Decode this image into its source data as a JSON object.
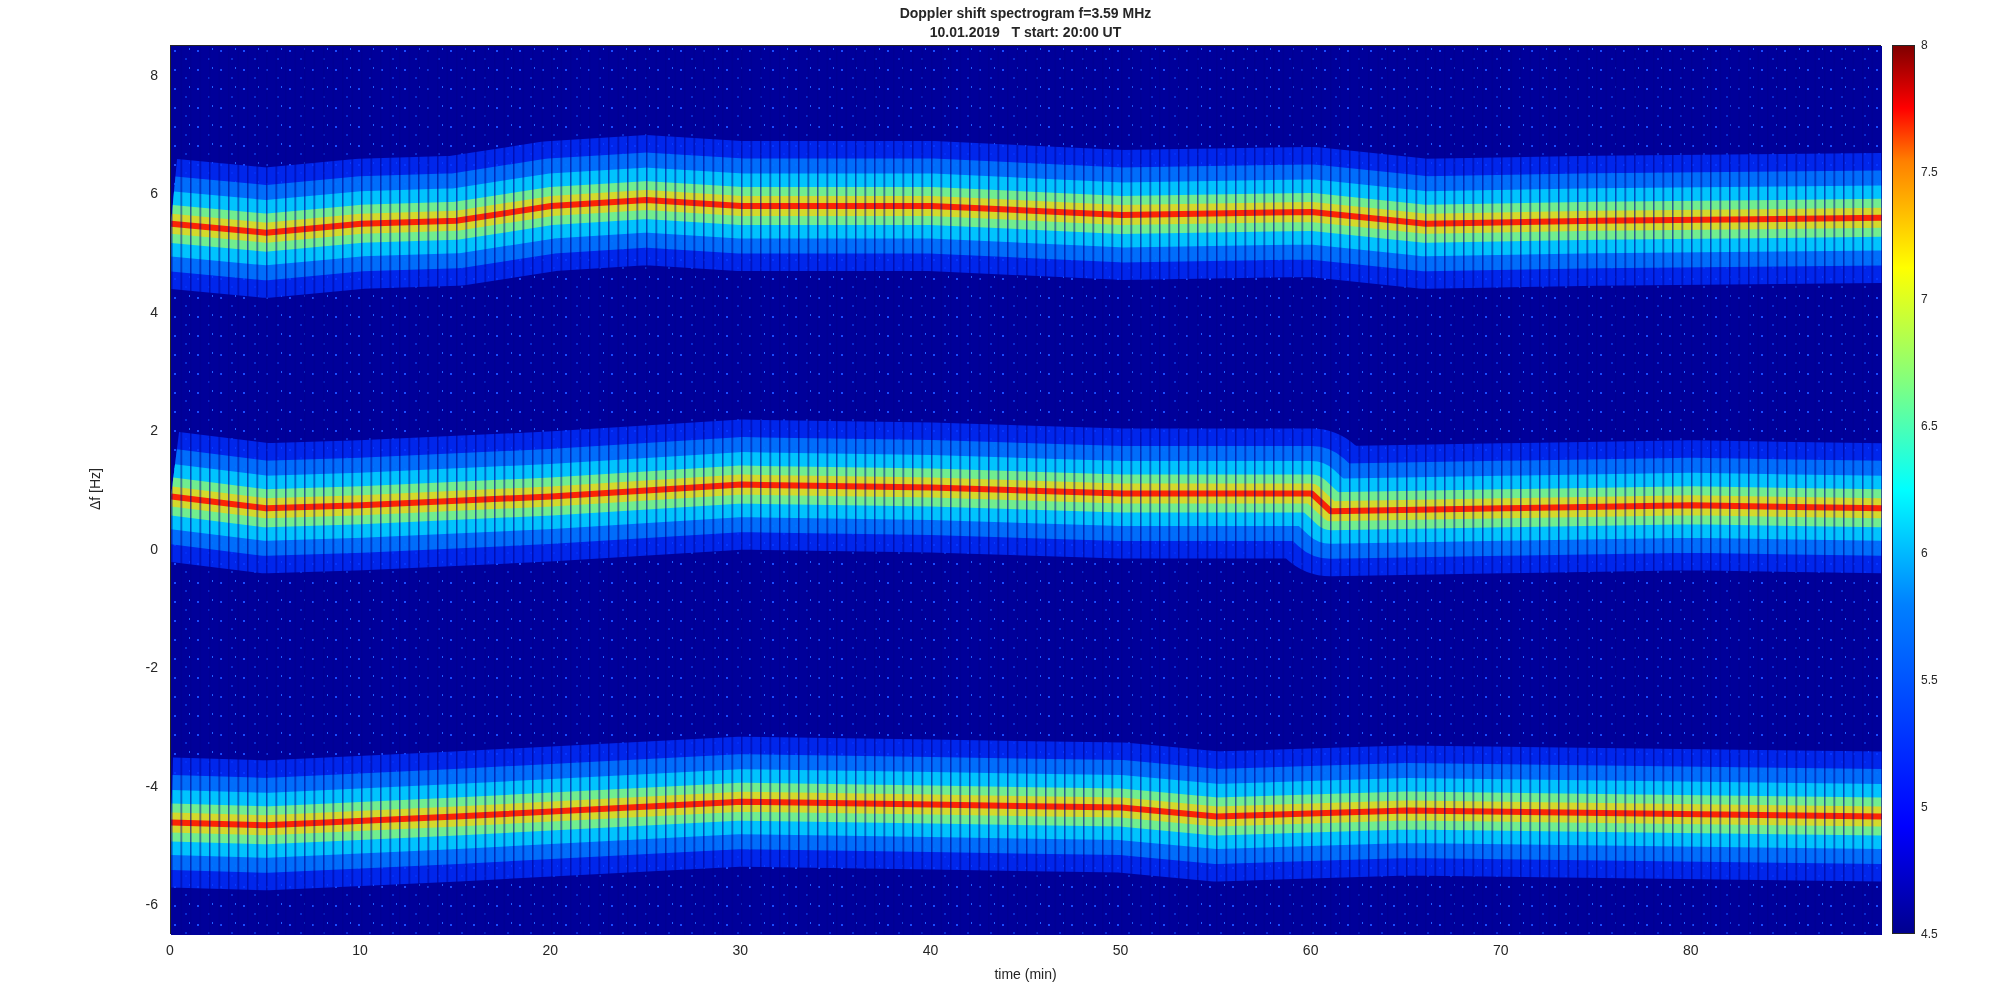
{
  "title": [
    "Doppler shift spectrogram f=3.59 MHz",
    "10.01.2019   T start: 20:00 UT"
  ],
  "y_axis": {
    "label": "Δf [Hz]",
    "ticks": [
      "8",
      "6",
      "4",
      "2",
      "0",
      "-2",
      "-4",
      "-6"
    ]
  },
  "x_axis": {
    "label": "time (min)",
    "ticks": [
      "0",
      "10",
      "20",
      "30",
      "40",
      "50",
      "60",
      "70",
      "80"
    ]
  },
  "colorbar": {
    "ticks": [
      "8",
      "7.5",
      "7",
      "6.5",
      "6",
      "5.5",
      "5",
      "4.5"
    ]
  }
}
